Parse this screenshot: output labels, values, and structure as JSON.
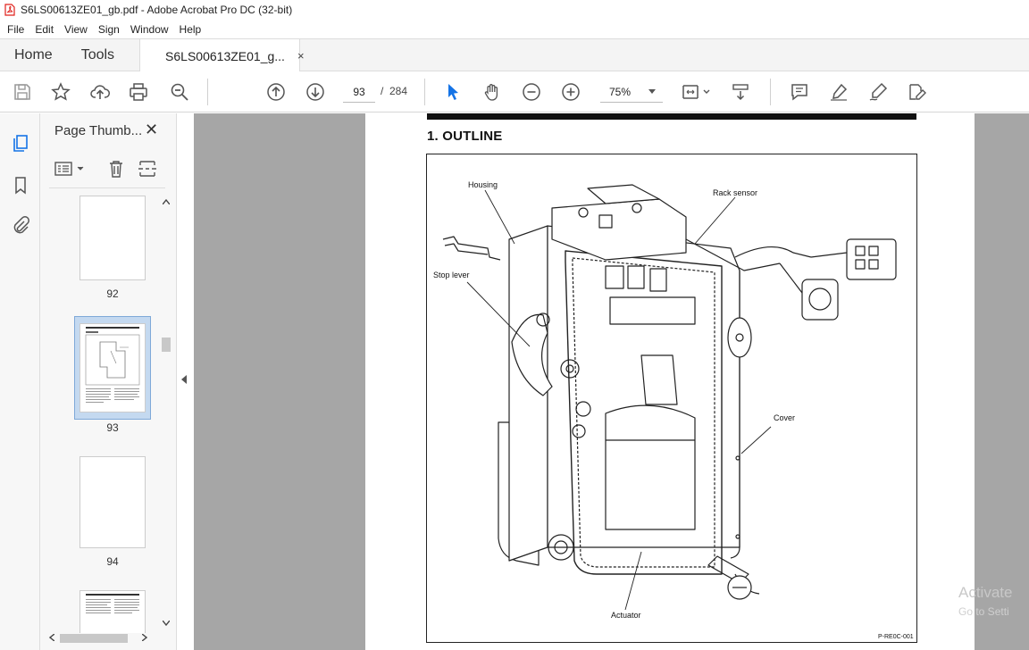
{
  "window": {
    "title": "S6LS00613ZE01_gb.pdf - Adobe Acrobat Pro DC (32-bit)"
  },
  "menu": [
    "File",
    "Edit",
    "View",
    "Sign",
    "Window",
    "Help"
  ],
  "tabs": {
    "home": "Home",
    "tools": "Tools",
    "document": "S6LS00613ZE01_g...",
    "close_glyph": "×"
  },
  "toolbar": {
    "current_page": "93",
    "page_sep": "/",
    "total_pages": "284",
    "zoom": "75%"
  },
  "icons": {
    "save": "save-icon",
    "bookmark": "star-icon",
    "upload": "upload-icon",
    "print": "print-icon",
    "search": "zoom-search-icon",
    "prev": "arrow-up-circle-icon",
    "next": "arrow-down-circle-icon",
    "select": "cursor-icon",
    "hand": "hand-icon",
    "zoom_out": "minus-circle-icon",
    "zoom_in": "plus-circle-icon",
    "fit": "fit-page-icon",
    "scroll": "scroll-mode-icon",
    "comment": "comment-icon",
    "highlight": "highlighter-icon",
    "draw": "pen-icon",
    "edit": "edit-icon"
  },
  "panel": {
    "title": "Page Thumb...",
    "close_glyph": "✕",
    "thumbnails": [
      {
        "label": "92"
      },
      {
        "label": "93",
        "selected": true
      },
      {
        "label": "94"
      }
    ]
  },
  "document": {
    "heading": "1.  OUTLINE",
    "figure_labels": {
      "housing": "Housing",
      "rack_sensor": "Rack sensor",
      "stop_lever": "Stop lever",
      "cover": "Cover",
      "actuator": "Actuator",
      "code": "P-RE0C-001"
    }
  },
  "watermark": {
    "line1": "Activate",
    "line2": "Go to Setti"
  },
  "colors": {
    "accent": "#1473e6",
    "pdf_red": "#e0201b",
    "canvas": "#a6a6a6"
  }
}
